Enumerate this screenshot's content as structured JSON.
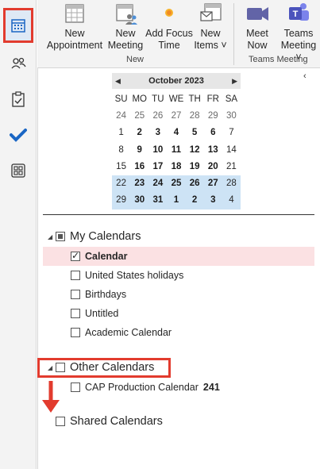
{
  "ribbon": {
    "new_appointment": {
      "line1": "New",
      "line2": "Appointment"
    },
    "new_meeting": {
      "line1": "New",
      "line2": "Meeting"
    },
    "add_focus_time": {
      "line1": "Add Focus",
      "line2": "Time"
    },
    "new_items": {
      "line1": "New",
      "line2": "Items ˅"
    },
    "group_new": "New",
    "meet_now": {
      "line1": "Meet",
      "line2": "Now"
    },
    "teams_meeting": {
      "line1": "Teams",
      "line2": "Meeting ˅"
    },
    "group_teams": "Teams Meeting"
  },
  "mini_calendar": {
    "title": "October 2023",
    "days_of_week": [
      "SU",
      "MO",
      "TU",
      "WE",
      "TH",
      "FR",
      "SA"
    ],
    "weeks": [
      [
        "24",
        "25",
        "26",
        "27",
        "28",
        "29",
        "30"
      ],
      [
        "1",
        "2",
        "3",
        "4",
        "5",
        "6",
        "7"
      ],
      [
        "8",
        "9",
        "10",
        "11",
        "12",
        "13",
        "14"
      ],
      [
        "15",
        "16",
        "17",
        "18",
        "19",
        "20",
        "21"
      ],
      [
        "22",
        "23",
        "24",
        "25",
        "26",
        "27",
        "28"
      ],
      [
        "29",
        "30",
        "31",
        "1",
        "2",
        "3",
        "4"
      ]
    ]
  },
  "folders": {
    "my_calendars": "My Calendars",
    "my_items": [
      "Calendar",
      "United States holidays",
      "Birthdays",
      "Untitled",
      "Academic Calendar"
    ],
    "other_calendars": "Other Calendars",
    "other_items": [
      {
        "label": "CAP Production Calendar",
        "count": "241"
      }
    ],
    "shared_calendars": "Shared Calendars"
  },
  "colors": {
    "highlight_red": "#e23b2e",
    "accent_blue": "#1a66c4",
    "selection_pink": "#fbe1e3",
    "week_blue": "#cde3f5"
  }
}
